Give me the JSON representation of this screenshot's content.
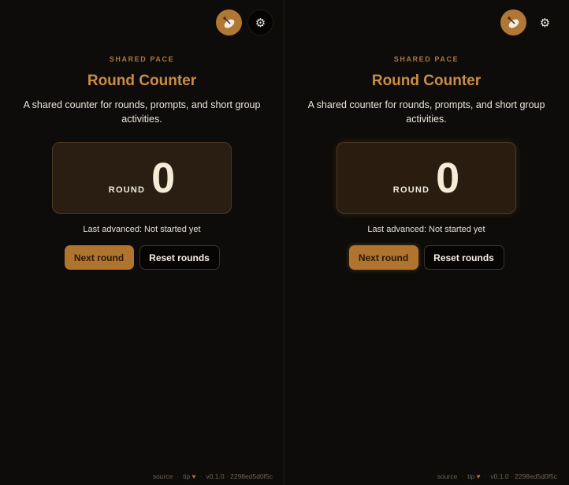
{
  "panes": [
    {
      "eyebrow": "SHARED PACE",
      "title": "Round Counter",
      "description": "A shared counter for rounds, prompts, and short group activities.",
      "counter_label": "ROUND",
      "counter_value": "0",
      "status": "Last advanced: Not started yet",
      "primary_button": "Next round",
      "secondary_button": "Reset rounds",
      "footer": {
        "source": "source",
        "tip": "tip",
        "version": "v0.1.0 · 2298ed5d0f5c"
      }
    },
    {
      "eyebrow": "SHARED PACE",
      "title": "Round Counter",
      "description": "A shared counter for rounds, prompts, and short group activities.",
      "counter_label": "ROUND",
      "counter_value": "0",
      "status": "Last advanced: Not started yet",
      "primary_button": "Next round",
      "secondary_button": "Reset rounds",
      "footer": {
        "source": "source",
        "tip": "tip",
        "version": "v0.1.0 · 2298ed5d0f5c"
      }
    }
  ],
  "icons": {
    "avatar": "satellite-dish-icon",
    "settings": "gear-icon",
    "heart": "heart-icon",
    "gear_glyph": "⚙",
    "heart_glyph": "♥",
    "dot": "·"
  },
  "colors": {
    "accent": "#b0742f",
    "title": "#c98d44",
    "background": "#0e0c0a",
    "counter_bg": "#2a1e12"
  }
}
